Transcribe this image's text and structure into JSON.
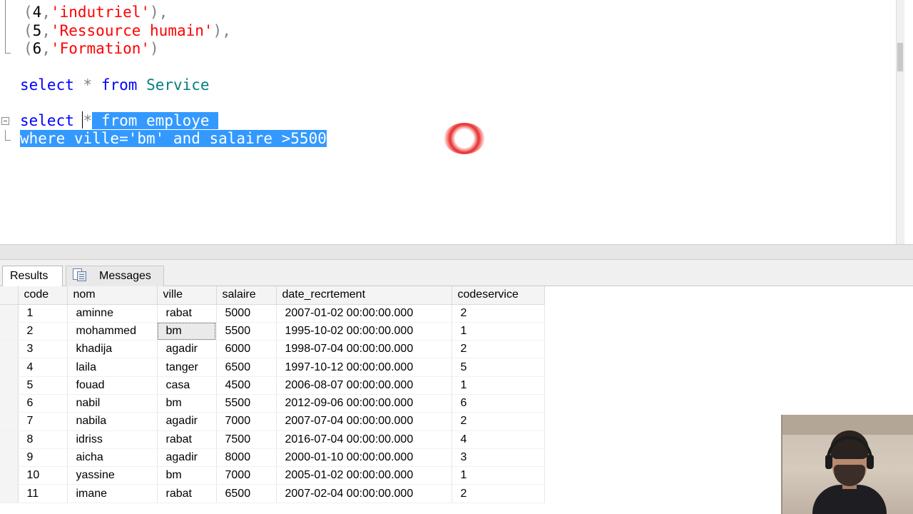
{
  "editor": {
    "lines": [
      {
        "parts": [
          [
            "punct",
            "("
          ],
          [
            "plain",
            "4"
          ],
          [
            "punct",
            ","
          ],
          [
            "str",
            "'indutriel'"
          ],
          [
            "punct",
            "),"
          ]
        ]
      },
      {
        "parts": [
          [
            "punct",
            "("
          ],
          [
            "plain",
            "5"
          ],
          [
            "punct",
            ","
          ],
          [
            "str",
            "'Ressource humain'"
          ],
          [
            "punct",
            "),"
          ]
        ]
      },
      {
        "parts": [
          [
            "punct",
            "("
          ],
          [
            "plain",
            "6"
          ],
          [
            "punct",
            ","
          ],
          [
            "str",
            "'Formation'"
          ],
          [
            "punct",
            ")"
          ]
        ]
      },
      {
        "parts": []
      },
      {
        "parts": [
          [
            "kw",
            "select"
          ],
          [
            "plain",
            " "
          ],
          [
            "op",
            "*"
          ],
          [
            "plain",
            " "
          ],
          [
            "kw",
            "from"
          ],
          [
            "plain",
            " "
          ],
          [
            "ident",
            "Service"
          ]
        ]
      },
      {
        "parts": []
      },
      {
        "parts": [
          [
            "kw",
            "select"
          ],
          [
            "plain",
            " "
          ],
          [
            "op",
            "*"
          ],
          [
            "sel",
            " from employe "
          ]
        ]
      },
      {
        "parts": [
          [
            "sel",
            "where ville='bm' and salaire >5500"
          ]
        ]
      }
    ]
  },
  "tabs": {
    "results_label": "Results",
    "messages_label": "Messages"
  },
  "grid": {
    "columns": [
      "code",
      "nom",
      "ville",
      "salaire",
      "date_recrtement",
      "codeservice"
    ],
    "rows": [
      [
        "1",
        "aminne",
        "rabat",
        "5000",
        "2007-01-02 00:00:00.000",
        "2"
      ],
      [
        "2",
        "mohammed",
        "bm",
        "5500",
        "1995-10-02 00:00:00.000",
        "1"
      ],
      [
        "3",
        "khadija",
        "agadir",
        "6000",
        "1998-07-04 00:00:00.000",
        "2"
      ],
      [
        "4",
        "laila",
        "tanger",
        "6500",
        "1997-10-12 00:00:00.000",
        "5"
      ],
      [
        "5",
        "fouad",
        "casa",
        "4500",
        "2006-08-07 00:00:00.000",
        "1"
      ],
      [
        "6",
        "nabil",
        "bm",
        "5500",
        "2012-09-06 00:00:00.000",
        "6"
      ],
      [
        "7",
        "nabila",
        "agadir",
        "7000",
        "2007-07-04 00:00:00.000",
        "2"
      ],
      [
        "8",
        "idriss",
        "rabat",
        "7500",
        "2016-07-04 00:00:00.000",
        "4"
      ],
      [
        "9",
        "aicha",
        "agadir",
        "8000",
        "2000-01-10 00:00:00.000",
        "3"
      ],
      [
        "10",
        "yassine",
        "bm",
        "7000",
        "2005-01-02 00:00:00.000",
        "1"
      ],
      [
        "11",
        "imane",
        "rabat",
        "6500",
        "2007-02-04 00:00:00.000",
        "2"
      ]
    ],
    "active_cell": {
      "row": 1,
      "col": 2
    }
  },
  "colors": {
    "keyword": "#0000ff",
    "string": "#ff0000",
    "selection": "#3399ff"
  }
}
